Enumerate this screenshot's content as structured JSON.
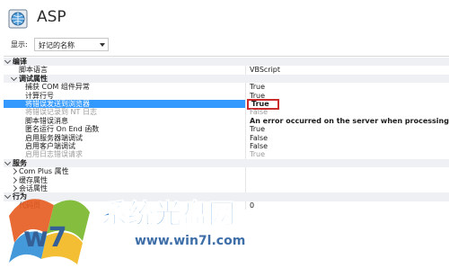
{
  "app": {
    "title": "ASP"
  },
  "toolbar": {
    "show_label": "显示:",
    "display_mode": "好记的名称"
  },
  "grid": {
    "rows": [
      {
        "type": "cat",
        "expander": "open",
        "name": "编译",
        "value": ""
      },
      {
        "type": "prop",
        "indent": 1,
        "name": "脚本语言",
        "value": "VBScript"
      },
      {
        "type": "cat",
        "expander": "open",
        "name": "调试属性",
        "value": "",
        "indent": 1
      },
      {
        "type": "prop",
        "indent": 2,
        "name": "捕获 COM 组件异常",
        "value": "True"
      },
      {
        "type": "prop",
        "indent": 2,
        "name": "计算行号",
        "value": "True"
      },
      {
        "type": "prop",
        "indent": 2,
        "name": "将错误发送到浏览器",
        "value": "True",
        "selected": true
      },
      {
        "type": "prop",
        "indent": 2,
        "name": "将错误记录到 NT 日志",
        "value": "False",
        "dim": true
      },
      {
        "type": "prop",
        "indent": 2,
        "name": "脚本错误消息",
        "value": "An error occurred on the server when processing th",
        "bold": true
      },
      {
        "type": "prop",
        "indent": 2,
        "name": "匿名运行 On End 函数",
        "value": "True"
      },
      {
        "type": "prop",
        "indent": 2,
        "name": "启用服务器端调试",
        "value": "False"
      },
      {
        "type": "prop",
        "indent": 2,
        "name": "启用客户端调试",
        "value": "False"
      },
      {
        "type": "prop",
        "indent": 2,
        "name": "启用日志错误请求",
        "value": "True",
        "dim": true
      },
      {
        "type": "cat",
        "expander": "open",
        "name": "服务",
        "value": ""
      },
      {
        "type": "prop",
        "indent": 1,
        "expander": "closed",
        "name": "Com Plus 属性",
        "value": ""
      },
      {
        "type": "prop",
        "indent": 1,
        "expander": "closed",
        "name": "缓存属性",
        "value": ""
      },
      {
        "type": "prop",
        "indent": 1,
        "expander": "closed",
        "name": "会话属性",
        "value": ""
      },
      {
        "type": "cat",
        "expander": "open",
        "name": "行为",
        "value": ""
      },
      {
        "type": "prop",
        "indent": 1,
        "name": "代码页",
        "value": "0"
      }
    ]
  },
  "watermark": {
    "brand": "系统光盘网",
    "url": "www.win7l.com",
    "logo_text": "w7"
  },
  "colors": {
    "selected_bg": "#3399ff",
    "category_bg": "#eef0f3",
    "highlight_box": "#cc2b2b"
  }
}
